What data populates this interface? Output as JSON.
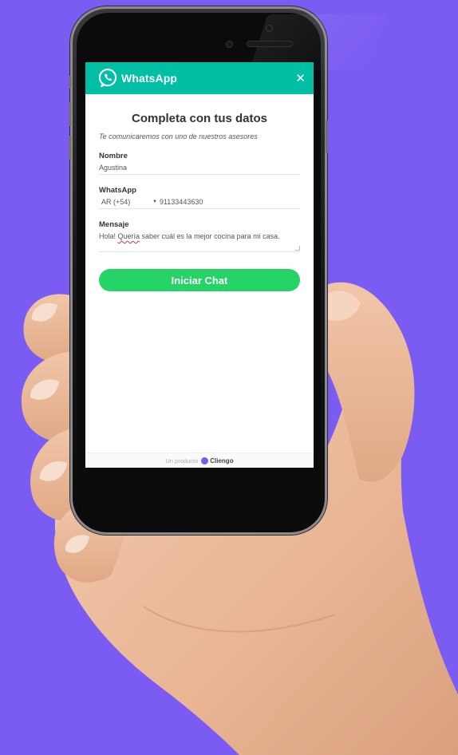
{
  "header": {
    "title": "WhatsApp",
    "close_icon": "close-icon",
    "brand_color": "#00bfa5"
  },
  "form": {
    "title": "Completa con tus datos",
    "subtitle": "Te comunicaremos con uno de nuestros asesores",
    "name": {
      "label": "Nombre",
      "value": "Agustina"
    },
    "whatsapp": {
      "label": "WhatsApp",
      "country": "AR (+54)",
      "number": "91133443630"
    },
    "message": {
      "label": "Mensaje",
      "value_pre": "Hola! ",
      "value_flagged": "Quería",
      "value_post": " saber cuál es la mejor cocina para mi casa."
    },
    "submit_label": "Iniciar Chat",
    "submit_color": "#25d366"
  },
  "footer": {
    "prefix": "Un producto",
    "brand": "Cliengo"
  },
  "background_color": "#7b5cf2"
}
